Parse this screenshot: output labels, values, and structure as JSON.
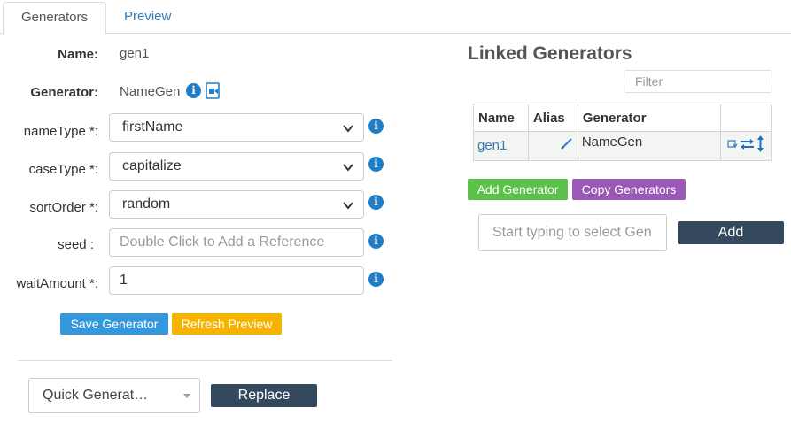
{
  "tabs": [
    {
      "label": "Generators",
      "active": true
    },
    {
      "label": "Preview",
      "active": false
    }
  ],
  "form": {
    "name_label": "Name:",
    "name_value": "gen1",
    "generator_label": "Generator:",
    "generator_value": "NameGen",
    "fields": [
      {
        "label": "nameType *:",
        "type": "select",
        "value": "firstName"
      },
      {
        "label": "caseType *:",
        "type": "select",
        "value": "capitalize"
      },
      {
        "label": "sortOrder *:",
        "type": "select",
        "value": "random"
      },
      {
        "label": "seed :",
        "type": "text",
        "value": "",
        "placeholder": "Double Click to Add a Reference"
      },
      {
        "label": "waitAmount *:",
        "type": "text",
        "value": "1",
        "placeholder": ""
      }
    ],
    "save_label": "Save Generator",
    "refresh_label": "Refresh Preview"
  },
  "quick": {
    "select_value": "Quick Generat…",
    "replace_label": "Replace"
  },
  "linked": {
    "title": "Linked Generators",
    "filter_placeholder": "Filter",
    "columns": [
      "Name",
      "Alias",
      "Generator",
      ""
    ],
    "rows": [
      {
        "name": "gen1",
        "alias": "",
        "generator": "NameGen"
      }
    ],
    "add_generator_label": "Add Generator",
    "copy_generators_label": "Copy Generators",
    "select_placeholder": "Start typing to select Gen",
    "add_label": "Add"
  },
  "colors": {
    "link": "#337ab7",
    "info": "#1e7fc8",
    "save": "#3498db",
    "refresh": "#f5b400",
    "add_generator": "#5cc04a",
    "copy_generators": "#9b59b6",
    "dark_button": "#34495e"
  },
  "icons": {
    "info": "info-circle-icon",
    "video": "video-icon",
    "select_chevron": "chevron-down-icon",
    "edit": "pencil-icon",
    "row_actions": [
      "retweet-icon",
      "exchange-icon",
      "vertical-arrows-icon"
    ]
  }
}
